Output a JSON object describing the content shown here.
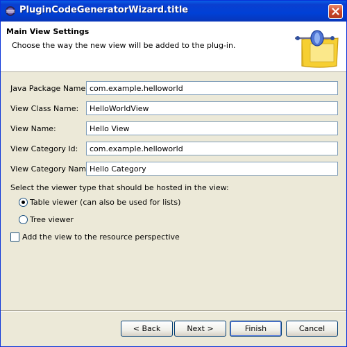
{
  "window": {
    "title": "PluginCodeGeneratorWizard.title"
  },
  "banner": {
    "title": "Main View Settings",
    "description": "Choose the way the new view will be added to the plug-in."
  },
  "form": {
    "fields": [
      {
        "label": "Java Package Name:",
        "value": "com.example.helloworld"
      },
      {
        "label": "View Class Name:",
        "value": "HelloWorldView"
      },
      {
        "label": "View Name:",
        "value": "Hello View"
      },
      {
        "label": "View Category Id:",
        "value": "com.example.helloworld"
      },
      {
        "label": "View Category Name:",
        "value": "Hello Category"
      }
    ],
    "viewer_prompt": "Select the viewer type that should be hosted in the view:",
    "viewer_options": [
      {
        "label": "Table viewer (can also be used for lists)",
        "selected": true
      },
      {
        "label": "Tree viewer",
        "selected": false
      }
    ],
    "perspective_checkbox": {
      "label": "Add the view to the resource perspective",
      "checked": false
    }
  },
  "buttons": {
    "back": "< Back",
    "next": "Next >",
    "finish": "Finish",
    "cancel": "Cancel"
  },
  "icons": {
    "title_icon": "eclipse-icon",
    "banner_icon": "plugin-wizard-icon",
    "close_icon": "close-icon"
  }
}
